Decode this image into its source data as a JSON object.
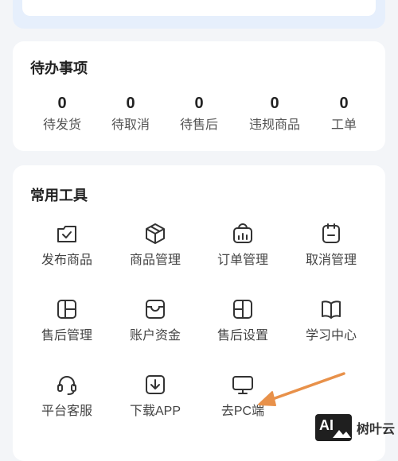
{
  "todo": {
    "title": "待办事项",
    "items": [
      {
        "value": "0",
        "label": "待发货"
      },
      {
        "value": "0",
        "label": "待取消"
      },
      {
        "value": "0",
        "label": "待售后"
      },
      {
        "value": "0",
        "label": "违规商品"
      },
      {
        "value": "0",
        "label": "工单"
      }
    ]
  },
  "tools": {
    "title": "常用工具",
    "items": [
      {
        "label": "发布商品",
        "icon": "publish-icon"
      },
      {
        "label": "商品管理",
        "icon": "box-icon"
      },
      {
        "label": "订单管理",
        "icon": "order-icon"
      },
      {
        "label": "取消管理",
        "icon": "cancel-icon"
      },
      {
        "label": "售后管理",
        "icon": "after-sale-icon"
      },
      {
        "label": "账户资金",
        "icon": "wallet-icon"
      },
      {
        "label": "售后设置",
        "icon": "after-sale-settings-icon"
      },
      {
        "label": "学习中心",
        "icon": "book-icon"
      },
      {
        "label": "平台客服",
        "icon": "headset-icon"
      },
      {
        "label": "下载APP",
        "icon": "download-icon"
      },
      {
        "label": "去PC端",
        "icon": "monitor-icon"
      }
    ]
  },
  "annotation": {
    "arrow_color": "#e8914a"
  },
  "watermark": {
    "logo_text": "AI",
    "text": "树叶云"
  },
  "colors": {
    "background": "#f3f5f8",
    "card": "#ffffff",
    "icon": "#333333"
  }
}
